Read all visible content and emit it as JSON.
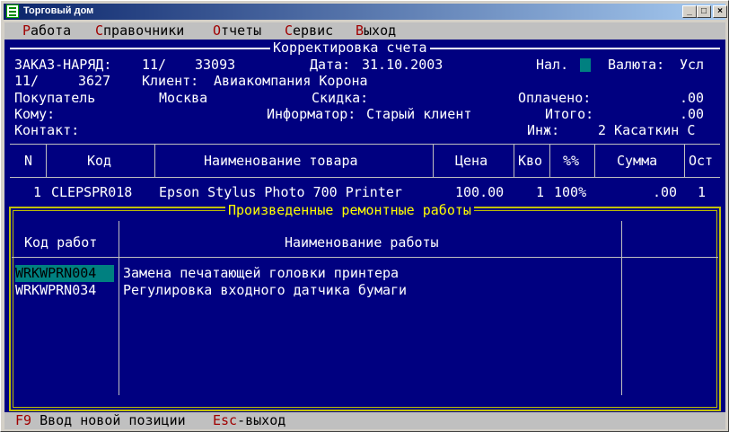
{
  "window": {
    "title": "Торговый дом",
    "min": "_",
    "max": "□",
    "close": "×"
  },
  "menu": [
    {
      "hot": "Р",
      "rest": "абота"
    },
    {
      "hot": "С",
      "rest": "правочники"
    },
    {
      "hot": "О",
      "rest": "тчеты"
    },
    {
      "hot": "С",
      "rest": "ервис"
    },
    {
      "hot": "В",
      "rest": "ыход"
    }
  ],
  "invoice": {
    "frame_title": "Корректировка счета",
    "order_label": "ЗАКАЗ-НАРЯД:",
    "order_v1": "11/",
    "order_v2": "33093",
    "date_label": "Дата:",
    "date_value": "31.10.2003",
    "nal_label": "Нал.",
    "currency_label": "Валюта:",
    "currency_value": "Усл",
    "line2_v1": "11/",
    "line2_v2": "3627",
    "client_label": "Клиент:",
    "client_value": "Авиакомпания Корона",
    "buyer_label": "Покупатель",
    "buyer_value": "Москва",
    "discount_label": "Скидка:",
    "paid_label": "Оплачено:",
    "paid_value": ".00",
    "to_label": "Кому:",
    "informer_label": "Информатор:",
    "informer_value": "Старый клиент",
    "total_label": "Итого:",
    "total_value": ".00",
    "contact_label": "Контакт:",
    "engineer_label": "Инж:",
    "engineer_value": "2 Касаткин С"
  },
  "items_table": {
    "headers": [
      "N",
      "Код",
      "Наименование товара",
      "Цена",
      "Кво",
      "%%",
      "Сумма",
      "Ост"
    ],
    "rows": [
      [
        "1",
        "CLEPSPR018",
        "Epson Stylus Photo 700 Printer",
        "100.00",
        "1",
        "100%",
        ".00",
        "1"
      ]
    ]
  },
  "repairs": {
    "frame_title": "Произведенные ремонтные работы",
    "headers": [
      "Код работ",
      "Наименование работы"
    ],
    "rows": [
      {
        "code": "WRKWPRN004",
        "name": "Замена печатающей головки принтера"
      },
      {
        "code": "WRKWPRN034",
        "name": "Регулировка входного датчика бумаги"
      }
    ]
  },
  "status": {
    "f9_key": "F9",
    "f9_text": " Ввод новой позиции ",
    "esc_key": "Esc",
    "esc_text": "-выход"
  }
}
